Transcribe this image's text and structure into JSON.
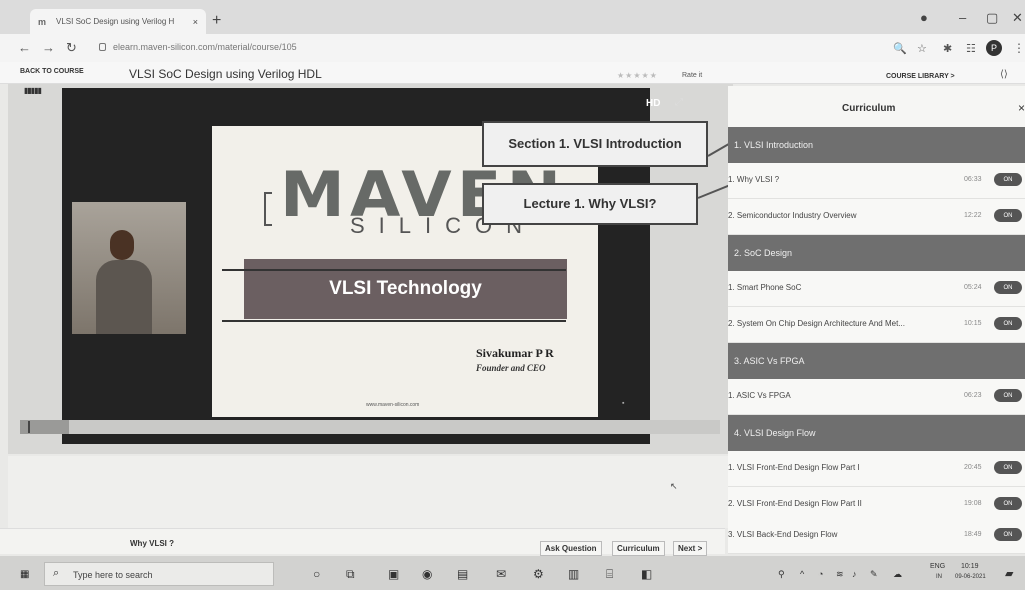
{
  "browser": {
    "tab_title": "VLSI SoC Design using Verilog H",
    "tab_close": "×",
    "new_tab": "+",
    "url": "elearn.maven-silicon.com/material/course/105"
  },
  "course": {
    "back_label": "BACK TO COURSE",
    "title": "VLSI SoC Design using Verilog HDL",
    "stars": "★★★★★",
    "rate_label": "Rate it",
    "library_label": "COURSE LIBRARY >"
  },
  "player": {
    "hd_label": "HD",
    "slide": {
      "logo_main": "MAVEN",
      "logo_sub": "SILICON",
      "band_text": "VLSI Technology",
      "presenter": "Sivakumar P R",
      "role": "Founder and CEO",
      "site": "www.maven-silicon.com"
    },
    "callouts": {
      "section": "Section 1. VLSI Introduction",
      "lecture": "Lecture 1. Why VLSI?"
    },
    "progress_fraction": 0.07
  },
  "lesson": {
    "name": "Why VLSI ?",
    "ask_label": "Ask Question",
    "curriculum_label": "Curriculum",
    "next_label": "Next >"
  },
  "curriculum": {
    "title": "Curriculum",
    "close": "×",
    "sections": [
      {
        "title": "1. VLSI Introduction",
        "lectures": [
          {
            "title": "1. Why VLSI ?",
            "duration": "06:33",
            "badge": "ON"
          },
          {
            "title": "2. Semiconductor Industry Overview",
            "duration": "12:22",
            "badge": "ON"
          }
        ]
      },
      {
        "title": "2. SoC Design",
        "lectures": [
          {
            "title": "1. Smart Phone SoC",
            "duration": "05:24",
            "badge": "ON"
          },
          {
            "title": "2. System On Chip Design Architecture And Met...",
            "duration": "10:15",
            "badge": "ON"
          }
        ]
      },
      {
        "title": "3. ASIC Vs FPGA",
        "lectures": [
          {
            "title": "1. ASIC Vs FPGA",
            "duration": "06:23",
            "badge": "ON"
          }
        ]
      },
      {
        "title": "4. VLSI Design Flow",
        "lectures": [
          {
            "title": "1. VLSI Front-End Design Flow Part I",
            "duration": "20:45",
            "badge": "ON"
          },
          {
            "title": "2. VLSI Front-End Design Flow Part II",
            "duration": "19:08",
            "badge": "ON"
          },
          {
            "title": "3. VLSI Back-End Design Flow",
            "duration": "18:49",
            "badge": "ON"
          }
        ]
      }
    ]
  },
  "taskbar": {
    "search_placeholder": "Type here to search",
    "lang_top": "ENG",
    "lang_bottom": "IN",
    "time": "10:19",
    "date": "09-06-2021"
  },
  "icons": {
    "windows": "windows-logo-icon",
    "search": "search-icon",
    "taskview": "task-view-icon",
    "chrome": "chrome-icon"
  }
}
